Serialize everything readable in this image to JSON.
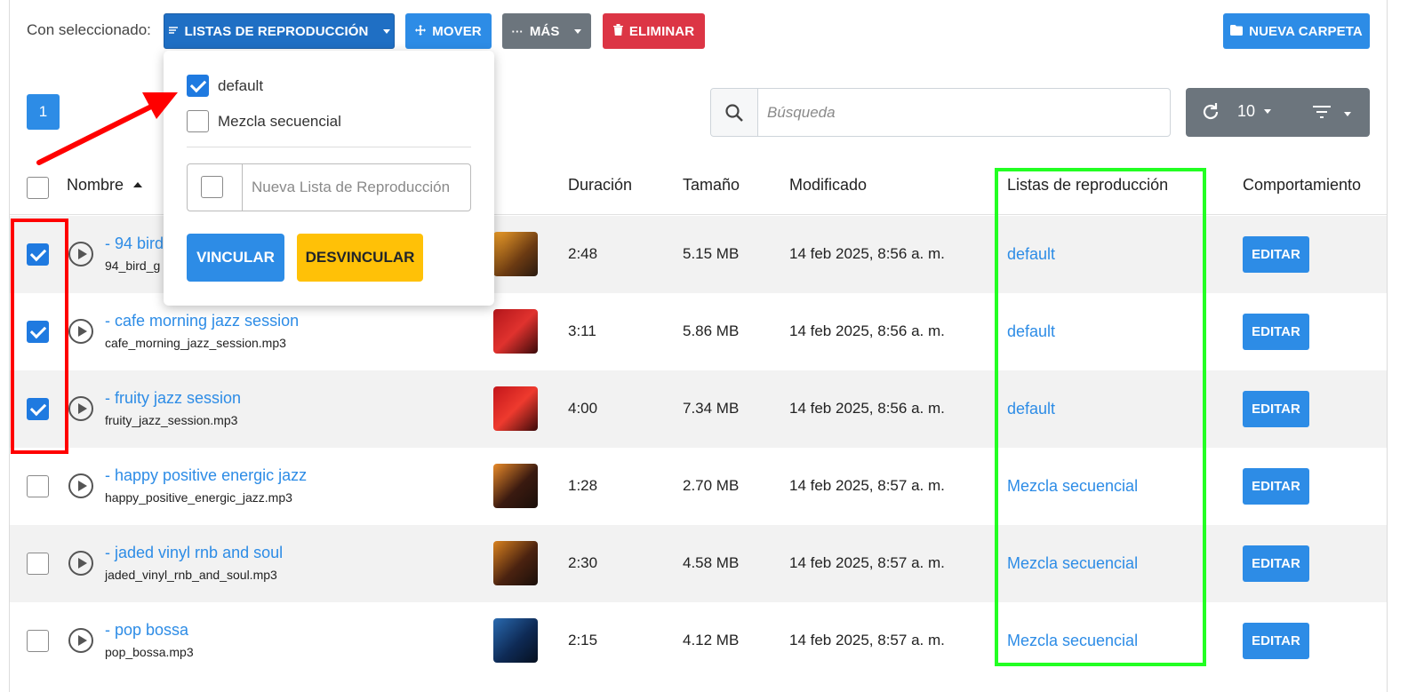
{
  "toolbar": {
    "label": "Con seleccionado:",
    "playlists_label": "LISTAS DE REPRODUCCIÓN",
    "move_label": "MOVER",
    "more_label": "MÁS",
    "delete_label": "ELIMINAR",
    "new_folder_label": "NUEVA CARPETA"
  },
  "pagination": {
    "current_page": "1"
  },
  "search": {
    "placeholder": "Búsqueda"
  },
  "controls": {
    "per_page": "10"
  },
  "table": {
    "headers": {
      "name": "Nombre",
      "duration": "Duración",
      "size": "Tamaño",
      "modified": "Modificado",
      "playlists": "Listas de reproducción",
      "behavior": "Comportamiento"
    },
    "edit_label": "EDITAR",
    "rows": [
      {
        "title": "- 94 bird",
        "file": "94_bird_g",
        "duration": "2:48",
        "size": "5.15 MB",
        "modified": "14 feb 2025, 8:56 a. m.",
        "playlist": "default",
        "checked": true
      },
      {
        "title": "- cafe morning jazz session",
        "file": "cafe_morning_jazz_session.mp3",
        "duration": "3:11",
        "size": "5.86 MB",
        "modified": "14 feb 2025, 8:56 a. m.",
        "playlist": "default",
        "checked": true
      },
      {
        "title": "- fruity jazz session",
        "file": "fruity_jazz_session.mp3",
        "duration": "4:00",
        "size": "7.34 MB",
        "modified": "14 feb 2025, 8:56 a. m.",
        "playlist": "default",
        "checked": true
      },
      {
        "title": "- happy positive energic jazz",
        "file": "happy_positive_energic_jazz.mp3",
        "duration": "1:28",
        "size": "2.70 MB",
        "modified": "14 feb 2025, 8:57 a. m.",
        "playlist": "Mezcla secuencial",
        "checked": false
      },
      {
        "title": "- jaded vinyl rnb and soul",
        "file": "jaded_vinyl_rnb_and_soul.mp3",
        "duration": "2:30",
        "size": "4.58 MB",
        "modified": "14 feb 2025, 8:57 a. m.",
        "playlist": "Mezcla secuencial",
        "checked": false
      },
      {
        "title": "- pop bossa",
        "file": "pop_bossa.mp3",
        "duration": "2:15",
        "size": "4.12 MB",
        "modified": "14 feb 2025, 8:57 a. m.",
        "playlist": "Mezcla secuencial",
        "checked": false
      }
    ]
  },
  "popup": {
    "options": [
      {
        "label": "default",
        "checked": true
      },
      {
        "label": "Mezcla secuencial",
        "checked": false
      }
    ],
    "new_playlist_placeholder": "Nueva Lista de Reproducción",
    "link_label": "VINCULAR",
    "unlink_label": "DESVINCULAR"
  },
  "colors": {
    "primary": "#2d8ce6",
    "danger": "#dc3545",
    "secondary": "#6c757d",
    "warning": "#ffc107",
    "annotation_red": "#ff0000",
    "annotation_green": "#22ff22"
  }
}
